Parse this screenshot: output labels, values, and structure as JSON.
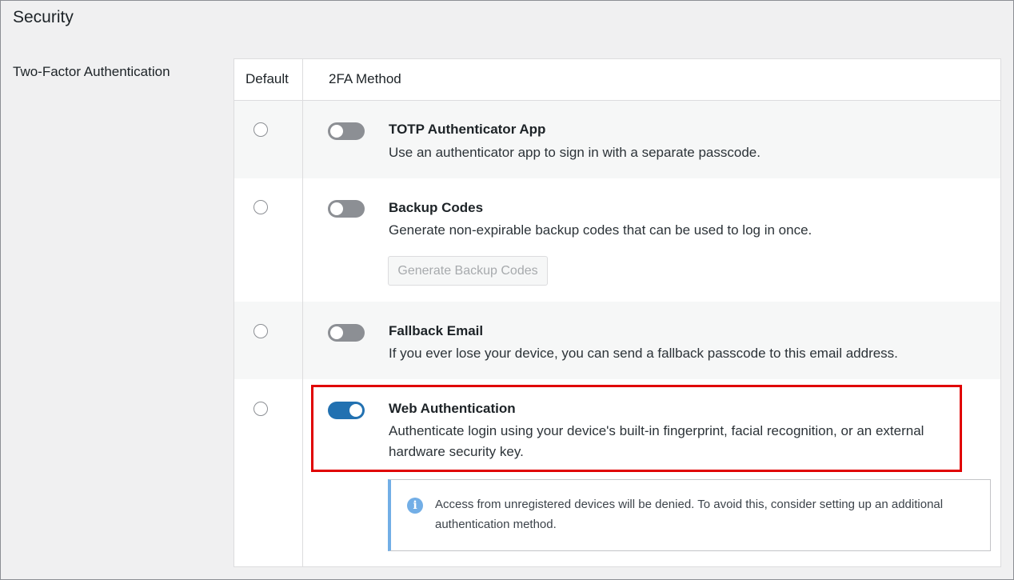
{
  "section": {
    "title": "Security"
  },
  "two_factor": {
    "label": "Two-Factor Authentication",
    "columns": {
      "default": "Default",
      "method": "2FA Method"
    },
    "methods": [
      {
        "title": "TOTP Authenticator App",
        "description": "Use an authenticator app to sign in with a separate passcode.",
        "enabled": false,
        "default": false
      },
      {
        "title": "Backup Codes",
        "description": "Generate non-expirable backup codes that can be used to log in once.",
        "enabled": false,
        "default": false,
        "button_label": "Generate Backup Codes"
      },
      {
        "title": "Fallback Email",
        "description": "If you ever lose your device, you can send a fallback passcode to this email address.",
        "enabled": false,
        "default": false
      },
      {
        "title": "Web Authentication",
        "description": "Authenticate login using your device's built-in fingerprint, facial recognition, or an external hardware security key.",
        "enabled": true,
        "default": false,
        "notice": "Access from unregistered devices will be denied. To avoid this, consider setting up an additional authentication method."
      }
    ]
  },
  "icons": {
    "notice": "info-icon"
  },
  "colors": {
    "toggle_on": "#2271b1",
    "toggle_off": "#8c8f94",
    "highlight": "#e00000",
    "notice_accent": "#72aee6"
  }
}
